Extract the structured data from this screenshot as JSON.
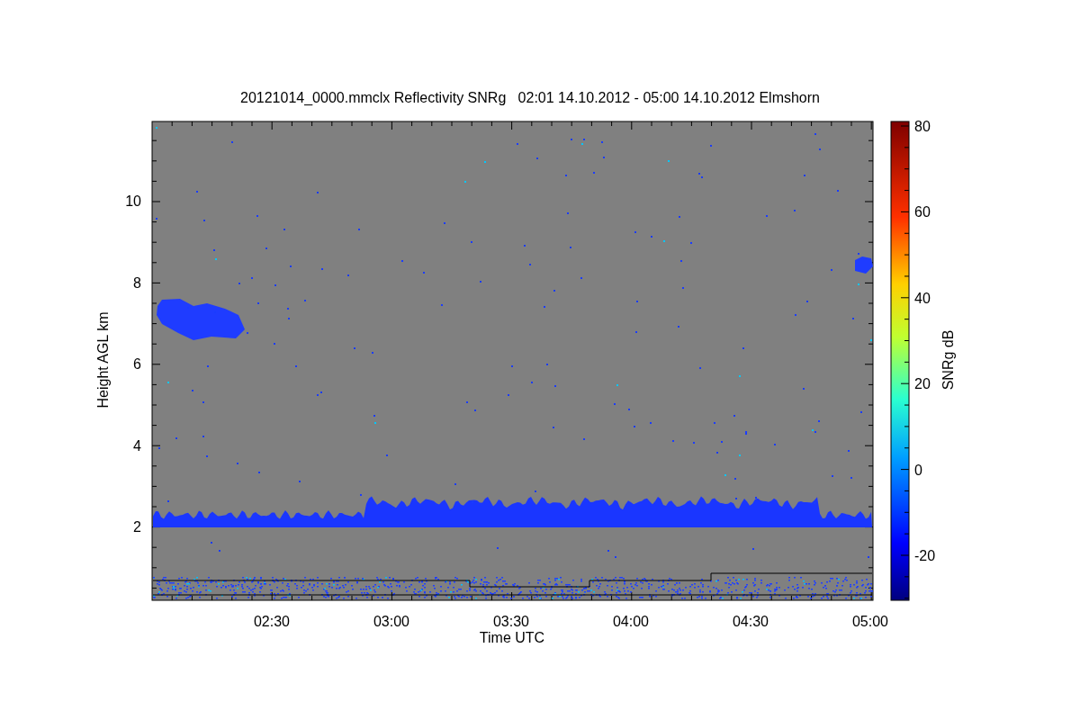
{
  "title": "20121014_0000.mmclx Reflectivity SNRg   02:01 14.10.2012 - 05:00 14.10.2012 Elmshorn",
  "plot": {
    "xlabel": "Time UTC",
    "ylabel": "Height AGL km",
    "xticks": [
      "02:30",
      "03:00",
      "03:30",
      "04:00",
      "04:30",
      "05:00"
    ],
    "yticks": [
      "10",
      "8",
      "6",
      "4",
      "2"
    ]
  },
  "colorbar": {
    "label": "SNRg dB",
    "ticks": [
      "80",
      "60",
      "40",
      "20",
      "0",
      "-20"
    ]
  }
}
